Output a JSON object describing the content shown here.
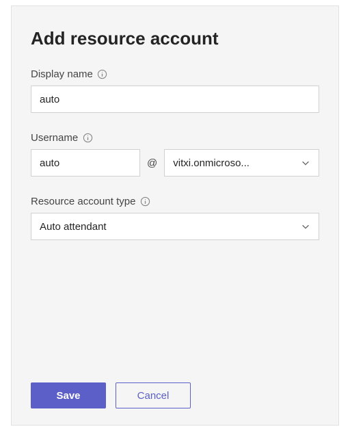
{
  "panel": {
    "title": "Add resource account"
  },
  "fields": {
    "displayName": {
      "label": "Display name",
      "value": "auto"
    },
    "username": {
      "label": "Username",
      "value": "auto",
      "at": "@",
      "domain": "vitxi.onmicroso..."
    },
    "accountType": {
      "label": "Resource account type",
      "value": "Auto attendant"
    }
  },
  "buttons": {
    "save": "Save",
    "cancel": "Cancel"
  }
}
